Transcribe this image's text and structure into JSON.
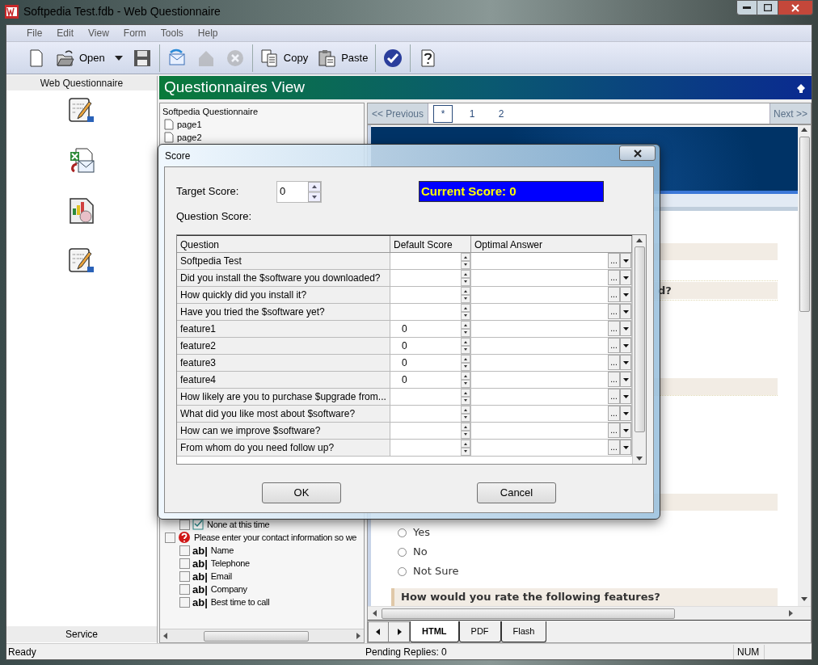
{
  "window": {
    "title": "Softpedia Test.fdb - Web Questionnaire"
  },
  "menu": [
    "File",
    "Edit",
    "View",
    "Form",
    "Tools",
    "Help"
  ],
  "toolbar": [
    [
      {
        "kind": "new",
        "disabled": false
      },
      {
        "kind": "open",
        "label": "Open",
        "disabled": false
      },
      {
        "kind": "menu",
        "disabled": false
      },
      {
        "kind": "save",
        "disabled": false
      }
    ],
    [
      {
        "kind": "mail",
        "disabled": false
      },
      {
        "kind": "publish",
        "disabled": true
      },
      {
        "kind": "stop",
        "disabled": true
      }
    ],
    [
      {
        "kind": "copy",
        "label": "Copy",
        "disabled": false
      },
      {
        "kind": "paste",
        "label": "Paste",
        "disabled": false
      }
    ],
    [
      {
        "kind": "check",
        "disabled": false
      }
    ],
    [
      {
        "kind": "help",
        "disabled": false
      }
    ]
  ],
  "sidebar": {
    "title": "Web Questionnaire",
    "items": [
      {
        "kind": "form"
      },
      {
        "kind": "mail-merge"
      },
      {
        "kind": "chart"
      },
      {
        "kind": "form"
      }
    ],
    "footer": "Service"
  },
  "header": {
    "title": "Questionnaires View"
  },
  "tree": {
    "top_items": [
      {
        "label": "Softpedia Questionnaire",
        "kind": "root"
      },
      {
        "label": "page1",
        "kind": "page"
      },
      {
        "label": "page2",
        "kind": "page"
      }
    ],
    "lower_items": [
      {
        "label": "None at this time",
        "kind": "choice",
        "checked": false
      },
      {
        "label": "Please enter your contact information so we",
        "kind": "question",
        "checked": false,
        "children": [
          {
            "label": "Name",
            "kind": "text",
            "glyph": "ab|",
            "checked": false
          },
          {
            "label": "Telephone",
            "kind": "text",
            "glyph": "ab|",
            "checked": false
          },
          {
            "label": "Email",
            "kind": "text",
            "glyph": "ab|",
            "checked": false
          },
          {
            "label": "Company",
            "kind": "text",
            "glyph": "ab|",
            "checked": false
          },
          {
            "label": "Best time to call",
            "kind": "text",
            "glyph": "ab|",
            "checked": false
          }
        ]
      }
    ]
  },
  "preview": {
    "previous": "<< Previous",
    "pages": [
      {
        "label": "*",
        "selected": true
      },
      {
        "label": "1",
        "selected": false
      },
      {
        "label": "2",
        "selected": false
      }
    ],
    "next": "Next >>",
    "heading_fragment": "d?",
    "options": [
      {
        "label": "Yes",
        "selected": false
      },
      {
        "label": "No",
        "selected": false
      },
      {
        "label": "Not Sure",
        "selected": false
      }
    ],
    "heading": "How would you rate the following features?",
    "tabs": [
      {
        "label": "HTML",
        "selected": true
      },
      {
        "label": "PDF",
        "selected": false
      },
      {
        "label": "Flash",
        "selected": false
      }
    ]
  },
  "dialog": {
    "title": "Score",
    "target_label": "Target Score:",
    "target_value": "0",
    "current_score": "Current Score: 0",
    "question_label": "Question Score:",
    "columns": [
      "Question",
      "Default Score",
      "Optimal Answer"
    ],
    "rows": [
      {
        "question": "Softpedia Test",
        "answer_button": "..."
      },
      {
        "question": "Did you install the $software you downloaded?",
        "answer_button": "..."
      },
      {
        "question": "How quickly did you install it?",
        "answer_button": "..."
      },
      {
        "question": "Have you tried the $software yet?",
        "answer_button": "..."
      },
      {
        "question": "feature1",
        "score": "0",
        "answer_button": "..."
      },
      {
        "question": "feature2",
        "score": "0",
        "answer_button": "..."
      },
      {
        "question": "feature3",
        "score": "0",
        "answer_button": "..."
      },
      {
        "question": "feature4",
        "score": "0",
        "answer_button": "..."
      },
      {
        "question": "How likely are you to purchase $upgrade from...",
        "answer_button": "..."
      },
      {
        "question": "What did you like most about $software?",
        "answer_button": "..."
      },
      {
        "question": "How can we improve $software?",
        "answer_button": "..."
      },
      {
        "question": "From whom do you need follow up?",
        "answer_button": "..."
      }
    ],
    "buttons": [
      "OK",
      "Cancel"
    ]
  },
  "status_bar": [
    "Ready",
    "Pending Replies: 0",
    "NUM"
  ]
}
